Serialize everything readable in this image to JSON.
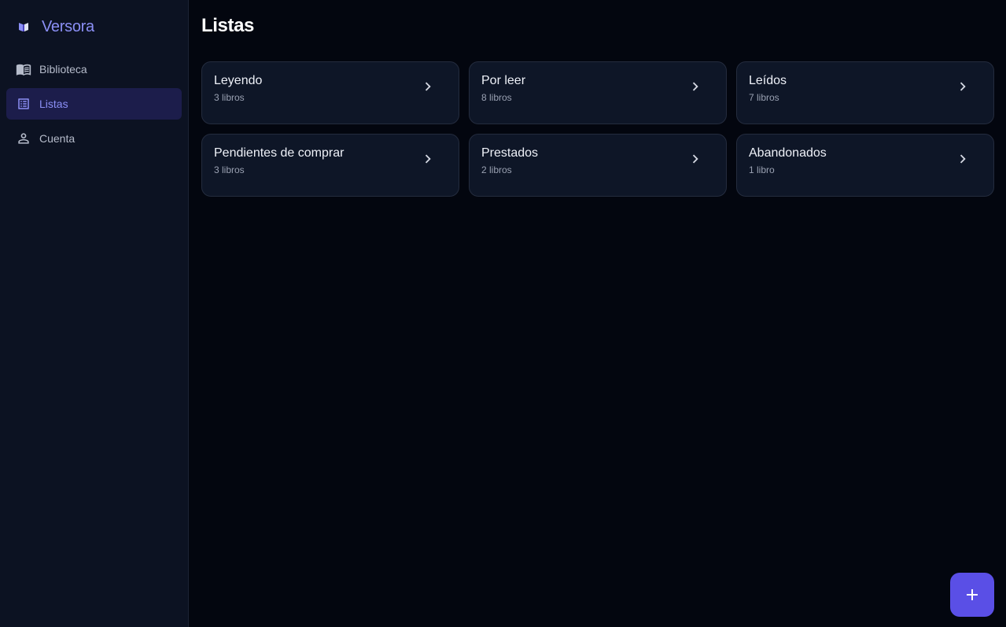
{
  "app": {
    "name": "Versora",
    "logo_icon": "book-logo-icon"
  },
  "sidebar": {
    "items": [
      {
        "label": "Biblioteca",
        "icon": "book-open-icon",
        "active": false
      },
      {
        "label": "Listas",
        "icon": "list-icon",
        "active": true
      },
      {
        "label": "Cuenta",
        "icon": "person-icon",
        "active": false
      }
    ]
  },
  "main": {
    "title": "Listas",
    "lists": [
      {
        "title": "Leyendo",
        "count": "3 libros"
      },
      {
        "title": "Por leer",
        "count": "8 libros"
      },
      {
        "title": "Leídos",
        "count": "7 libros"
      },
      {
        "title": "Pendientes de comprar",
        "count": "3 libros"
      },
      {
        "title": "Prestados",
        "count": "2 libros"
      },
      {
        "title": "Abandonados",
        "count": "1 libro"
      }
    ],
    "fab_icon": "plus-icon"
  },
  "colors": {
    "accent": "#8b8ff5",
    "fab": "#5a4fe6",
    "background": "#03060f",
    "sidebar": "#0c1222",
    "card": "#0e1627"
  }
}
